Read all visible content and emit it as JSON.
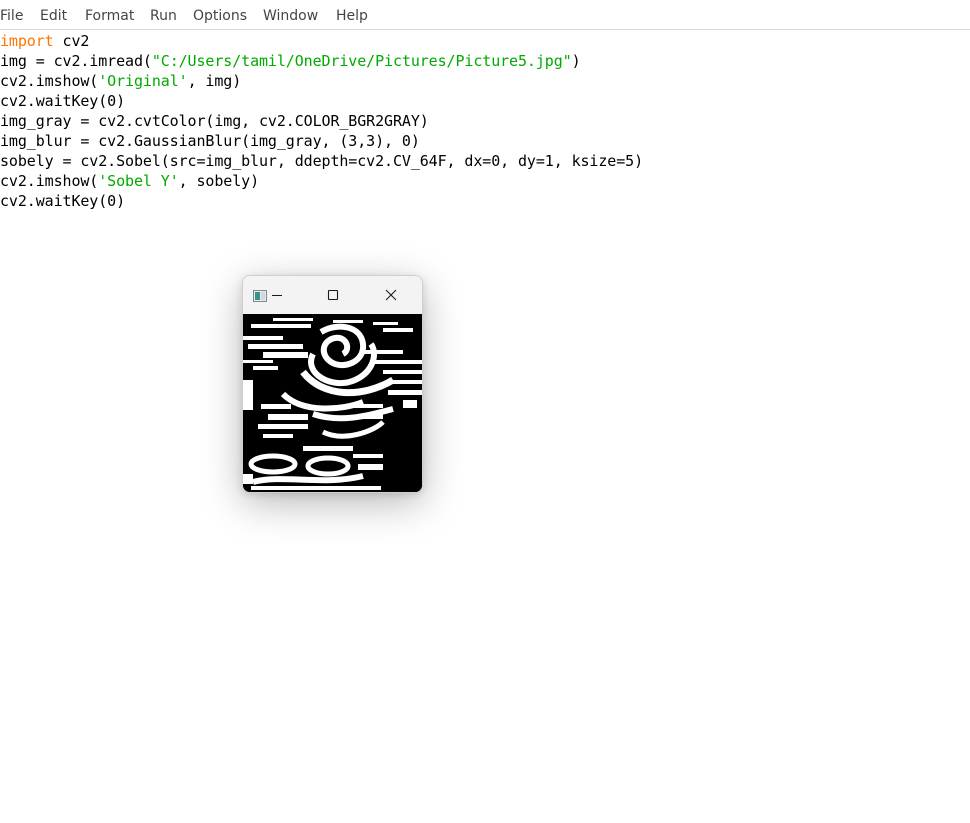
{
  "menubar": {
    "items": [
      "File",
      "Edit",
      "Format",
      "Run",
      "Options",
      "Window",
      "Help"
    ]
  },
  "editor": {
    "lines": [
      {
        "kw": "import",
        "rest": " cv2"
      },
      {
        "pre": "img = cv2.imread(",
        "str": "\"C:/Users/tamil/OneDrive/Pictures/Picture5.jpg\"",
        "post": ")"
      },
      {
        "pre": "cv2.imshow(",
        "str": "'Original'",
        "post": ", img)"
      },
      {
        "pre": "cv2.waitKey(0)"
      },
      {
        "pre": "img_gray = cv2.cvtColor(img, cv2.COLOR_BGR2GRAY)"
      },
      {
        "pre": "img_blur = cv2.GaussianBlur(img_gray, (3,3), 0)"
      },
      {
        "pre": "sobely = cv2.Sobel(src=img_blur, ddepth=cv2.CV_64F, dx=0, dy=1, ksize=5)"
      },
      {
        "pre": "cv2.imshow(",
        "str": "'Sobel Y'",
        "post": ", sobely)"
      },
      {
        "pre": "cv2.waitKey(0)"
      }
    ]
  },
  "cv_window": {
    "app_icon": "opencv-window-icon",
    "minimize_icon": "minimize-icon",
    "maximize_icon": "maximize-icon",
    "close_icon": "close-icon",
    "image_description_icon": "sobel-edge-image"
  },
  "colors": {
    "keyword": "#ff7700",
    "string": "#00aa00",
    "text": "#000000",
    "menu_text": "#444444"
  }
}
